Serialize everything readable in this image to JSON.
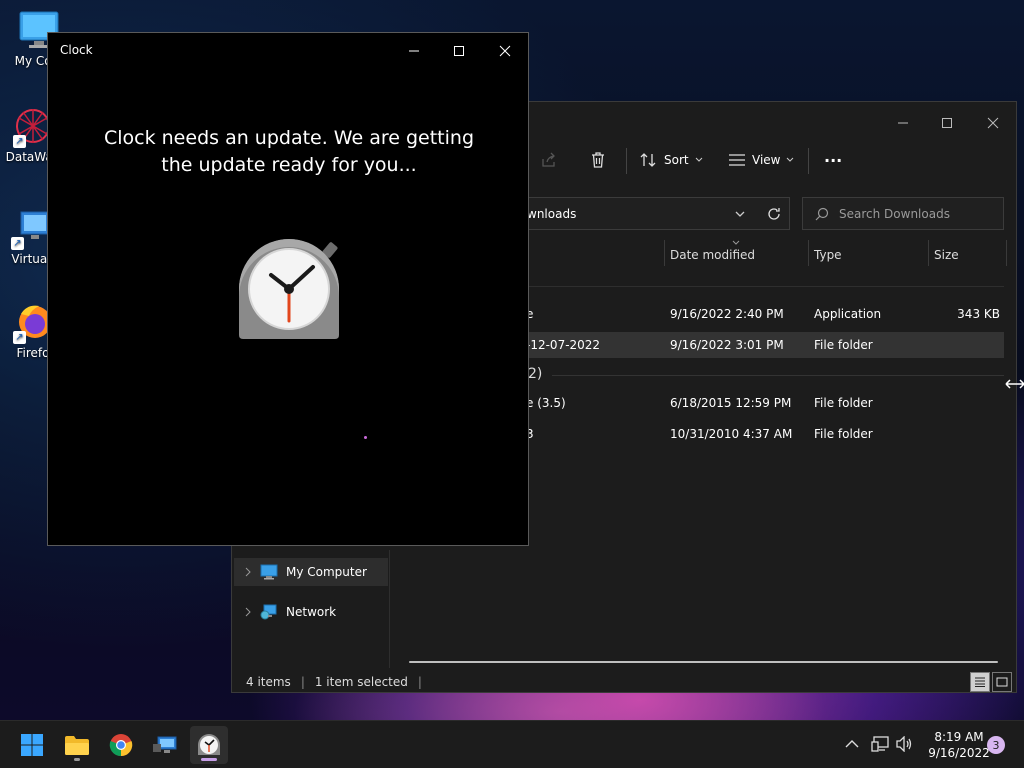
{
  "desktop": {
    "icons": [
      {
        "label": "My Com",
        "icon": "monitor-icon"
      },
      {
        "label": "DataWag",
        "icon": "datawag-icon"
      },
      {
        "label": "Virtual",
        "icon": "virtual-machine-icon"
      },
      {
        "label": "Firefo",
        "icon": "firefox-icon"
      }
    ]
  },
  "explorer": {
    "toolbar": {
      "sort_label": "Sort",
      "view_label": "View",
      "more_label": "···"
    },
    "address": {
      "text": "wnloads"
    },
    "search": {
      "placeholder": "Search Downloads"
    },
    "columns": {
      "date": "Date modified",
      "type": "Type",
      "size": "Size"
    },
    "rows": [
      {
        "name": "e",
        "date": "9/16/2022 2:40 PM",
        "type": "Application",
        "size": "343 KB",
        "selected": false
      },
      {
        "name": "-12-07-2022",
        "date": "9/16/2022 3:01 PM",
        "type": "File folder",
        "size": "",
        "selected": true
      }
    ],
    "group": {
      "label": "2)"
    },
    "group_rows": [
      {
        "name": "e (3.5)",
        "date": "6/18/2015 12:59 PM",
        "type": "File folder",
        "size": ""
      },
      {
        "name": "3",
        "date": "10/31/2010 4:37 AM",
        "type": "File folder",
        "size": ""
      }
    ],
    "nav": [
      {
        "label": "My Computer",
        "icon": "monitor-icon"
      },
      {
        "label": "Network",
        "icon": "network-icon"
      }
    ],
    "status": {
      "items_count": "4 items",
      "selected": "1 item selected"
    }
  },
  "clock_window": {
    "title": "Clock",
    "message_line1": "Clock needs an update. We are getting",
    "message_line2": "the update ready for you..."
  },
  "taskbar": {
    "apps": [
      "start-icon",
      "file-explorer-icon",
      "chrome-icon",
      "remote-desktop-icon",
      "clock-app-icon"
    ],
    "time": "8:19 AM",
    "date": "9/16/2022",
    "notifications": "3"
  }
}
